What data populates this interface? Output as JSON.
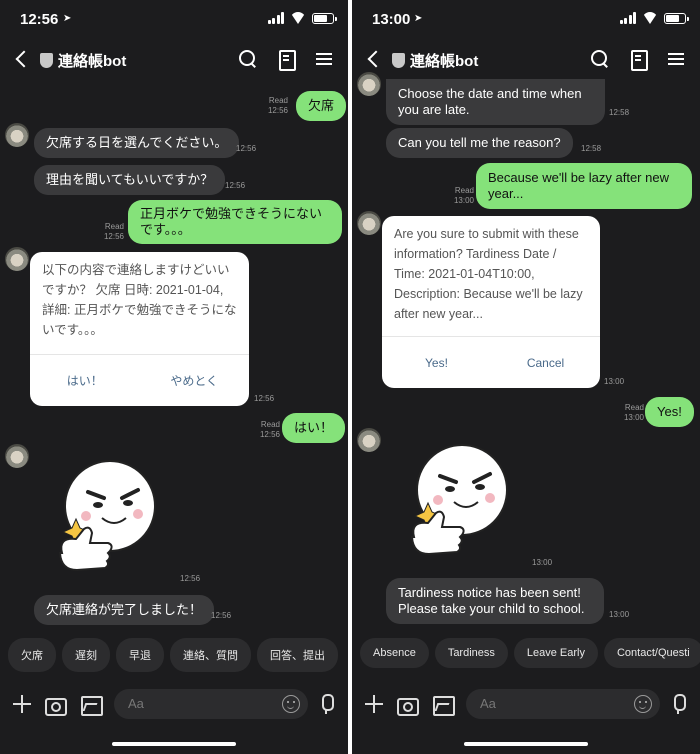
{
  "left": {
    "status": {
      "time": "12:56"
    },
    "header": {
      "title": "連絡帳bot"
    },
    "messages": {
      "m1": {
        "text": "欠席",
        "read": "Read",
        "time": "12:56"
      },
      "m2": {
        "text": "欠席する日を選んでください。",
        "time": "12:56"
      },
      "m3": {
        "text": "理由を聞いてもいいですか？",
        "time": "12:56"
      },
      "m4": {
        "text": "正月ボケで勉強できそうにないです。。。",
        "read": "Read",
        "time": "12:56"
      },
      "card": {
        "text": "以下の内容で連絡しますけどいいですか？ 欠席 日時: 2021-01-04, 詳細: 正月ボケで勉強できそうにないです。。。",
        "yes": "はい！",
        "no": "やめとく",
        "time": "12:56"
      },
      "m5": {
        "text": "はい！",
        "read": "Read",
        "time": "12:56"
      },
      "sticker_time": "12:56",
      "m6": {
        "text": "欠席連絡が完了しました！",
        "time": "12:56"
      }
    },
    "quick_replies": [
      "欠席",
      "遅刻",
      "早退",
      "連絡、質問",
      "回答、提出"
    ],
    "input": {
      "placeholder": "Aa"
    }
  },
  "right": {
    "status": {
      "time": "13:00"
    },
    "header": {
      "title": "連絡帳bot"
    },
    "messages": {
      "m1": {
        "text": "Choose the date and time when you are late.",
        "time": "12:58"
      },
      "m2": {
        "text": "Can you tell me the reason?",
        "time": "12:58"
      },
      "m3": {
        "text": "Because we'll be lazy after new year...",
        "read": "Read",
        "time": "13:00"
      },
      "card": {
        "text": "Are you sure to submit with these information? Tardiness Date / Time: 2021-01-04T10:00, Description: Because we'll be lazy after new year...",
        "yes": "Yes!",
        "no": "Cancel",
        "time": "13:00"
      },
      "m4": {
        "text": "Yes!",
        "read": "Read",
        "time": "13:00"
      },
      "sticker_time": "13:00",
      "m5": {
        "text": "Tardiness notice has been sent! Please take your child to school.",
        "time": "13:00"
      }
    },
    "quick_replies": [
      "Absence",
      "Tardiness",
      "Leave Early",
      "Contact/Questi"
    ],
    "input": {
      "placeholder": "Aa"
    }
  },
  "colors": {
    "sent_bubble": "#85e27a",
    "received_bubble": "#3a3a3c",
    "background": "#1c1c1e"
  }
}
